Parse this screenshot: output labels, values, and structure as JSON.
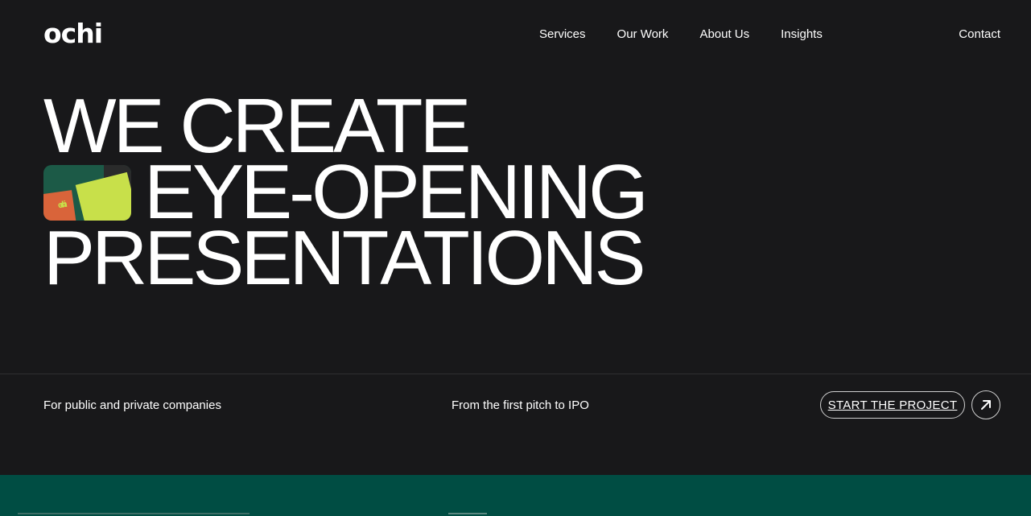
{
  "brand": {
    "logo": "ochi"
  },
  "nav": {
    "links": [
      "Services",
      "Our Work",
      "About Us",
      "Insights"
    ],
    "contact": "Contact"
  },
  "hero": {
    "line1": "WE CREATE",
    "line2": "EYE-OPENING",
    "line3": "PRESENTATIONS",
    "thumb_text": "ochi"
  },
  "info": {
    "left": "For public and private companies",
    "middle": "From the first pitch to IPO",
    "cta_label": "START THE PROJECT",
    "cta_icon": "arrow-up-right-icon"
  },
  "colors": {
    "background": "#18181a",
    "band": "#004d43",
    "lime": "#c8e04a",
    "orange": "#d9643a"
  }
}
